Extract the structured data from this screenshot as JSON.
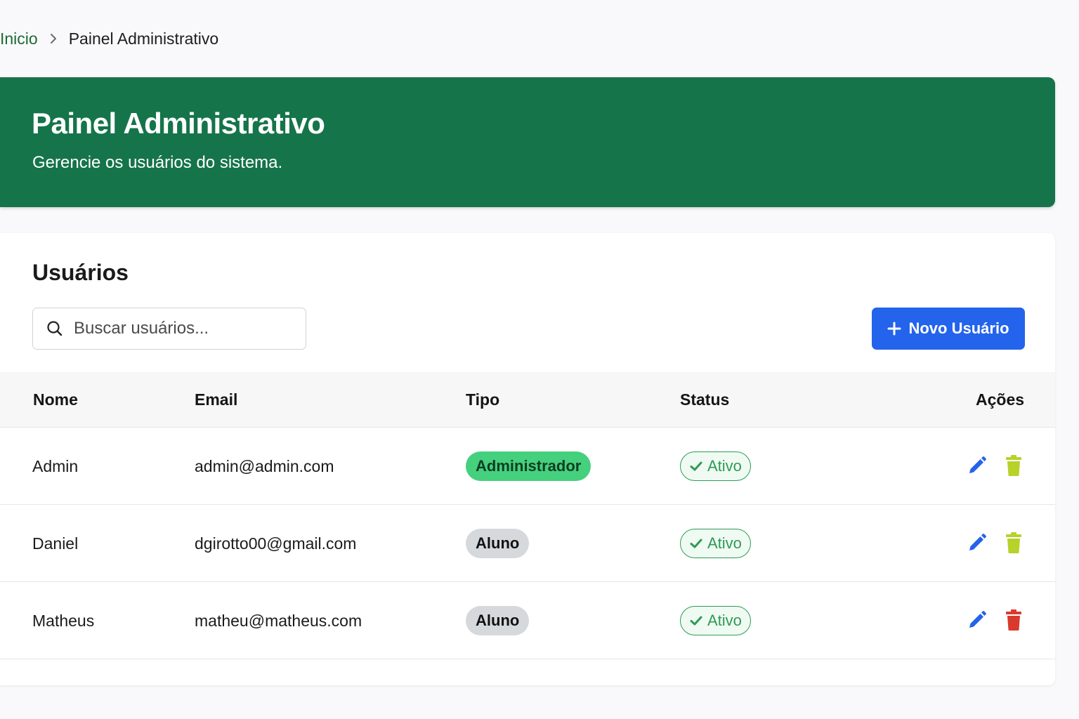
{
  "breadcrumb": {
    "home": "Inicio",
    "current": "Painel Administrativo"
  },
  "hero": {
    "title": "Painel Administrativo",
    "subtitle": "Gerencie os usuários do sistema."
  },
  "users_card": {
    "title": "Usuários",
    "search_placeholder": "Buscar usuários...",
    "new_button_label": "Novo Usuário"
  },
  "table": {
    "headers": {
      "name": "Nome",
      "email": "Email",
      "type": "Tipo",
      "status": "Status",
      "actions": "Ações"
    },
    "rows": [
      {
        "name": "Admin",
        "email": "admin@admin.com",
        "type": "Administrador",
        "status": "Ativo",
        "delete_color": "#b8d22a"
      },
      {
        "name": "Daniel",
        "email": "dgirotto00@gmail.com",
        "type": "Aluno",
        "status": "Ativo",
        "delete_color": "#b8d22a"
      },
      {
        "name": "Matheus",
        "email": "matheu@matheus.com",
        "type": "Aluno",
        "status": "Ativo",
        "delete_color": "#d93a2e"
      }
    ]
  },
  "icons": {
    "search": "search-icon",
    "plus": "plus-icon",
    "check": "check-icon",
    "edit": "pencil-icon",
    "delete": "trash-icon",
    "separator": "chevron-right-icon"
  },
  "colors": {
    "brand_green": "#15744a",
    "primary_blue": "#2463eb",
    "edit_blue": "#2463eb",
    "status_green": "#2e9b55",
    "admin_badge": "#45d07e",
    "aluno_badge": "#d5d9dc"
  }
}
